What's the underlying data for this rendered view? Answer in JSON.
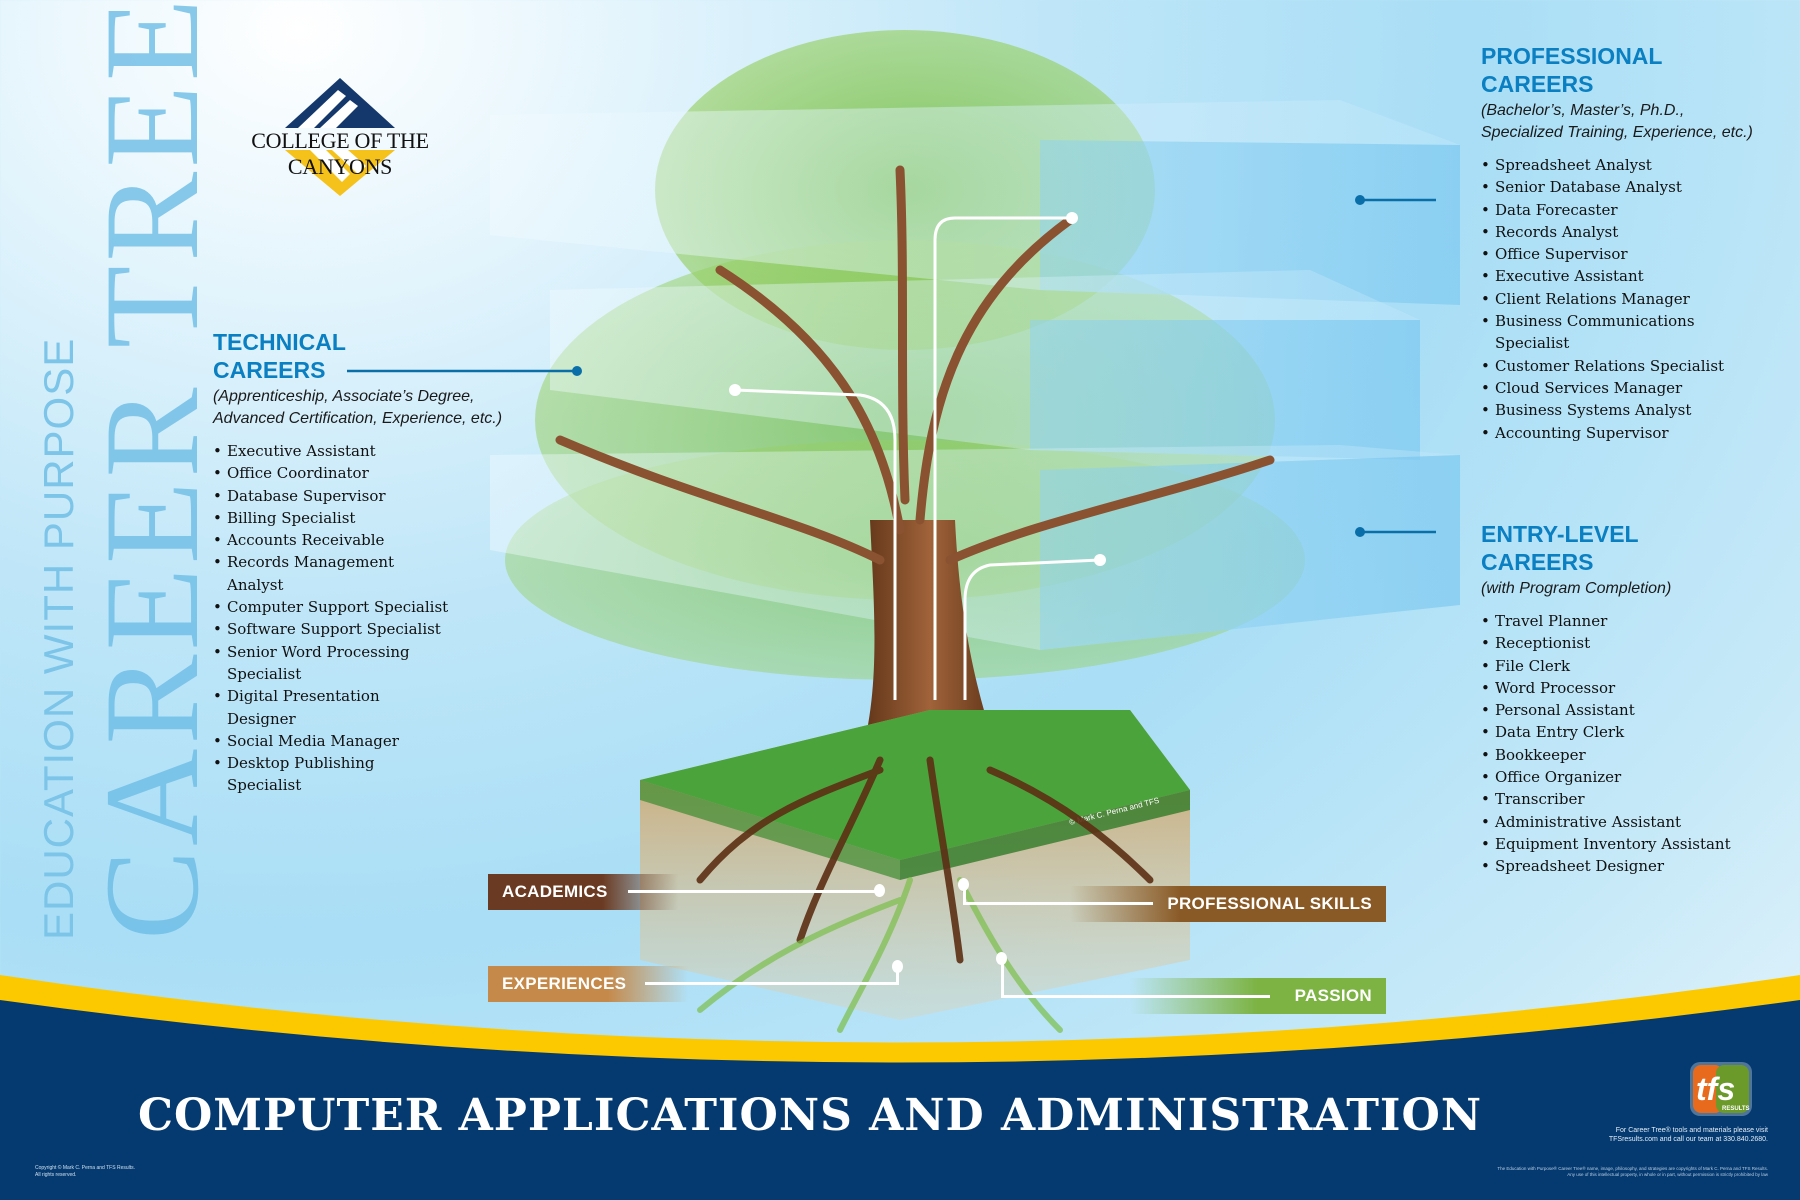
{
  "watermark": {
    "subtitle": "EDUCATION WITH PURPOSE",
    "title": "CAREER TREE",
    "registered_mark": "®"
  },
  "logo": {
    "name": "COLLEGE OF THE CANYONS",
    "colors": {
      "navy": "#14386b",
      "gold": "#f5c21b"
    }
  },
  "technical": {
    "title_line1": "TECHNICAL",
    "title_line2": "CAREERS",
    "subtitle_line1": "(Apprenticeship, Associate’s Degree,",
    "subtitle_line2": "Advanced Certification, Experience, etc.)",
    "items": [
      "Executive Assistant",
      "Office Coordinator",
      "Database Supervisor",
      "Billing Specialist",
      "Accounts Receivable",
      "Records Management Analyst",
      "Computer Support Specialist",
      "Software Support Specialist",
      "Senior Word Processing Specialist",
      "Digital Presentation Designer",
      "Social Media Manager",
      "Desktop Publishing Specialist"
    ]
  },
  "professional": {
    "title_line1": "PROFESSIONAL",
    "title_line2": "CAREERS",
    "subtitle_line1": "(Bachelor’s, Master’s, Ph.D.,",
    "subtitle_line2": "Specialized Training, Experience, etc.)",
    "items": [
      "Spreadsheet Analyst",
      "Senior Database Analyst",
      "Data Forecaster",
      "Records Analyst",
      "Office Supervisor",
      "Executive Assistant",
      "Client Relations Manager",
      "Business Communications Specialist",
      "Customer Relations Specialist",
      "Cloud Services Manager",
      "Business Systems Analyst",
      "Accounting Supervisor"
    ]
  },
  "entry_level": {
    "title_line1": "ENTRY-LEVEL",
    "title_line2": "CAREERS",
    "subtitle_line1": "(with Program Completion)",
    "items": [
      "Travel Planner",
      "Receptionist",
      "File Clerk",
      "Word Processor",
      "Personal Assistant",
      "Data Entry Clerk",
      "Bookkeeper",
      "Office Organizer",
      "Transcriber",
      "Administrative Assistant",
      "Equipment Inventory Assistant",
      "Spreadsheet Designer"
    ]
  },
  "roots": {
    "academics": {
      "label": "ACADEMICS",
      "color": "#6b3a22"
    },
    "professional_skills": {
      "label": "PROFESSIONAL SKILLS",
      "color": "#8a5a26"
    },
    "experiences": {
      "label": "EXPERIENCES",
      "color": "#c58a4a"
    },
    "passion": {
      "label": "PASSION",
      "color": "#7cb342"
    }
  },
  "art_credit": "© Mark C. Perna and TFS",
  "footer": {
    "title": "COMPUTER APPLICATIONS AND ADMINISTRATION",
    "copyright_line1": "Copyright © Mark C. Perna and TFS Results.",
    "copyright_line2": "All rights reserved.",
    "tfs_logo_text": "tfs",
    "tfs_logo_sub": "RESULTS",
    "info_line1": "For Career Tree® tools and materials please visit",
    "info_line2": "TFSresults.com and call our team at 330.840.2680.",
    "legal_line1": "The Education with Purpose® Career Tree® name, image, philosophy, and strategies are copyrights of Mark C. Perna and TFS Results.",
    "legal_line2": "Any use of this intellectual property, in whole or in part, without permission is strictly prohibited by law",
    "colors": {
      "navy": "#053a70",
      "gold": "#fcc800"
    }
  },
  "accent_color": "#0a7fc2"
}
